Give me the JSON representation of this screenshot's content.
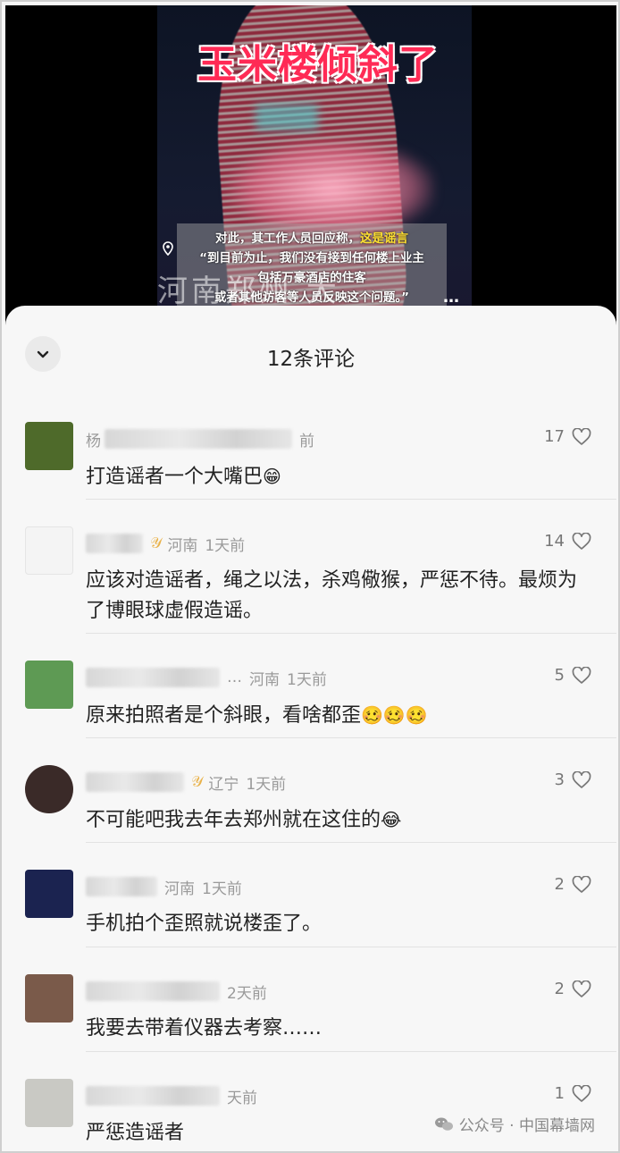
{
  "video": {
    "title": "玉米楼倾斜了",
    "subtitle_lines": [
      {
        "plain": "对此，其工作人员回应称，",
        "highlight": "这是谣言"
      },
      {
        "plain": "“到目前为止，我们没有接到任何楼上业主",
        "highlight": ""
      },
      {
        "plain": "包括万豪酒店的住客",
        "highlight": ""
      },
      {
        "plain": "或者其他访客等人员反映这个问题。”",
        "highlight": ""
      }
    ],
    "city_watermark": "河南郑州  大",
    "more_label": "…"
  },
  "sheet": {
    "title": "12条评论",
    "collapse_icon": "chevron-down-icon"
  },
  "comments": [
    {
      "name_width": 210,
      "badge": "",
      "meta_prefix": "杨",
      "meta_suffix": "前",
      "location": "",
      "time": "",
      "text": "打造谣者一个大嘴巴",
      "emoji": "😁",
      "likes": "17",
      "avatar_color": "#4e6a2a"
    },
    {
      "name_width": 64,
      "badge": "𝒴",
      "meta_prefix": "",
      "meta_suffix": "",
      "location": "河南",
      "time": "1天前",
      "text": "应该对造谣者，绳之以法，杀鸡儆猴，严惩不待。最烦为了博眼球虚假造谣。",
      "emoji": "",
      "likes": "14",
      "avatar_color": "#f4f4f4"
    },
    {
      "name_width": 150,
      "badge": "",
      "meta_prefix": "",
      "meta_suffix": "…",
      "location": "河南",
      "time": "1天前",
      "text": "原来拍照者是个斜眼，看啥都歪",
      "emoji": "🥴🥴🥴",
      "likes": "5",
      "avatar_color": "#5e9a54"
    },
    {
      "name_width": 110,
      "badge": "𝒴",
      "meta_prefix": "",
      "meta_suffix": "",
      "location": "辽宁",
      "time": "1天前",
      "text": "不可能吧我去年去郑州就在这住的",
      "emoji": "😂",
      "likes": "3",
      "avatar_color": "#3a2a28"
    },
    {
      "name_width": 80,
      "badge": "",
      "meta_prefix": "",
      "meta_suffix": "",
      "location": "河南",
      "time": "1天前",
      "text": "手机拍个歪照就说楼歪了。",
      "emoji": "",
      "likes": "2",
      "avatar_color": "#1b2350"
    },
    {
      "name_width": 150,
      "badge": "",
      "meta_prefix": "",
      "meta_suffix": "",
      "location": "",
      "time": "2天前",
      "text": "我要去带着仪器去考察……",
      "emoji": "",
      "likes": "2",
      "avatar_color": "#7a5a4a"
    },
    {
      "name_width": 150,
      "badge": "",
      "meta_prefix": "",
      "meta_suffix": "",
      "location": "",
      "time": "天前",
      "text": "严惩造谣者",
      "emoji": "",
      "likes": "1",
      "avatar_color": "#c9c9c4"
    }
  ],
  "footer": {
    "label": "公众号 · 中国幕墙网",
    "icon": "wechat-icon"
  }
}
